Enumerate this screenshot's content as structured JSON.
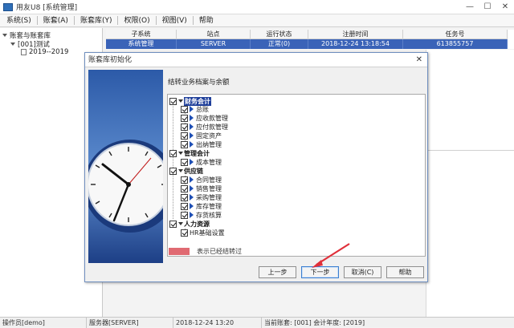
{
  "window": {
    "title": "用友U8 [系统管理]"
  },
  "window_controls": {
    "minimize": "—",
    "maximize": "☐",
    "close": "✕"
  },
  "menu": [
    "系统(S)",
    "账套(A)",
    "账套库(Y)",
    "权限(O)",
    "视图(V)",
    "帮助"
  ],
  "tree": {
    "root": "账套与账套库",
    "account": "[001]测试",
    "year": "2019--2019"
  },
  "grid": {
    "headers": [
      "子系统",
      "站点",
      "运行状态",
      "注册时间",
      "任务号"
    ],
    "row": [
      "系统管理",
      "SERVER",
      "正常(0)",
      "2018-12-24 13:18:54",
      "613855757"
    ]
  },
  "status": {
    "operator": "操作员[demo]",
    "server": "服务器[SERVER]",
    "datetime": "2018-12-24 13:20",
    "current": "当前账套: [001] 会计年度: [2019]"
  },
  "dialog": {
    "title": "账套库初始化",
    "close": "✕",
    "heading": "结转业务档案与余额",
    "groups": [
      {
        "label": "财务会计",
        "items": [
          "总账",
          "应收款管理",
          "应付款管理",
          "固定资产",
          "出纳管理"
        ]
      },
      {
        "label": "管理会计",
        "items": [
          "成本管理"
        ]
      },
      {
        "label": "供应链",
        "items": [
          "合同管理",
          "销售管理",
          "采购管理",
          "库存管理",
          "存货核算"
        ]
      },
      {
        "label": "人力资源",
        "items": [
          "HR基础设置"
        ]
      }
    ],
    "legend": "表示已经结转过",
    "legend_color": "#e06a72",
    "buttons": {
      "prev": "上一步",
      "next": "下一步",
      "cancel": "取消(C)",
      "help": "帮助"
    }
  },
  "colors": {
    "selection": "#3a63b8",
    "accent_blue": "#1e4fb5",
    "arrow": "#e0303a"
  }
}
